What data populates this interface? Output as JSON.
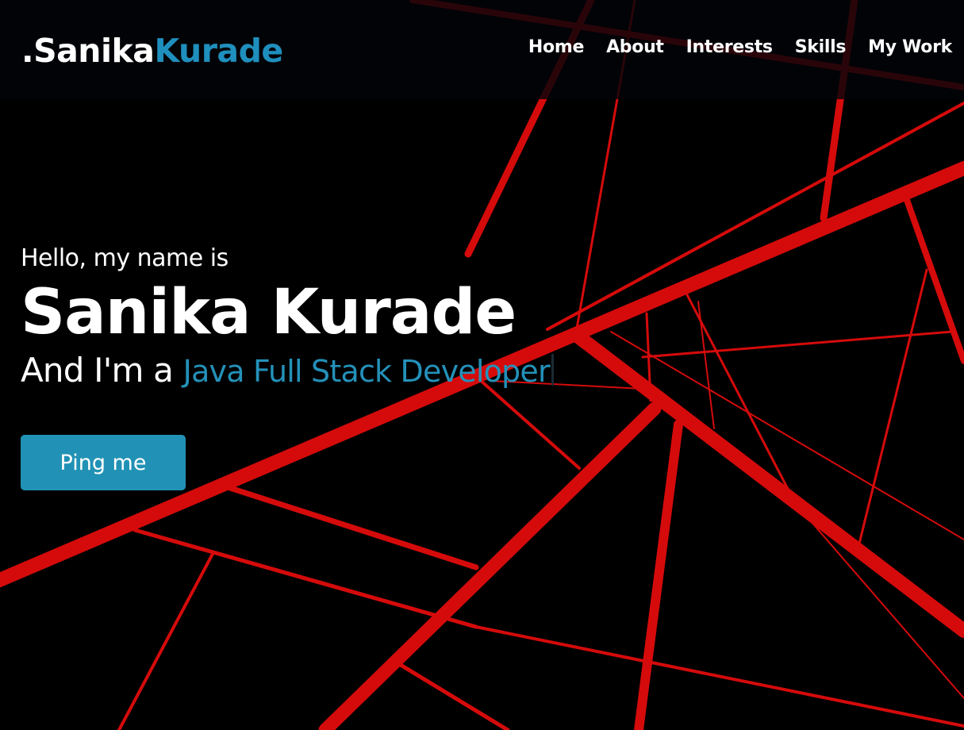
{
  "brand": {
    "prefix": ".Sanika",
    "accent": "Kurade",
    "accent_color": "#1f8fbd"
  },
  "nav": {
    "items": [
      {
        "label": "Home"
      },
      {
        "label": "About"
      },
      {
        "label": "Interests"
      },
      {
        "label": "Skills"
      },
      {
        "label": "My Work"
      }
    ]
  },
  "hero": {
    "greeting": "Hello, my name is",
    "name": "Sanika Kurade",
    "role_prefix": "And I'm a ",
    "role_typed": "Java Full Stack Developer",
    "button_label": "Ping me"
  },
  "theme": {
    "background": "#000000",
    "line_color": "#d50b0b",
    "button_color": "#2192b5"
  }
}
